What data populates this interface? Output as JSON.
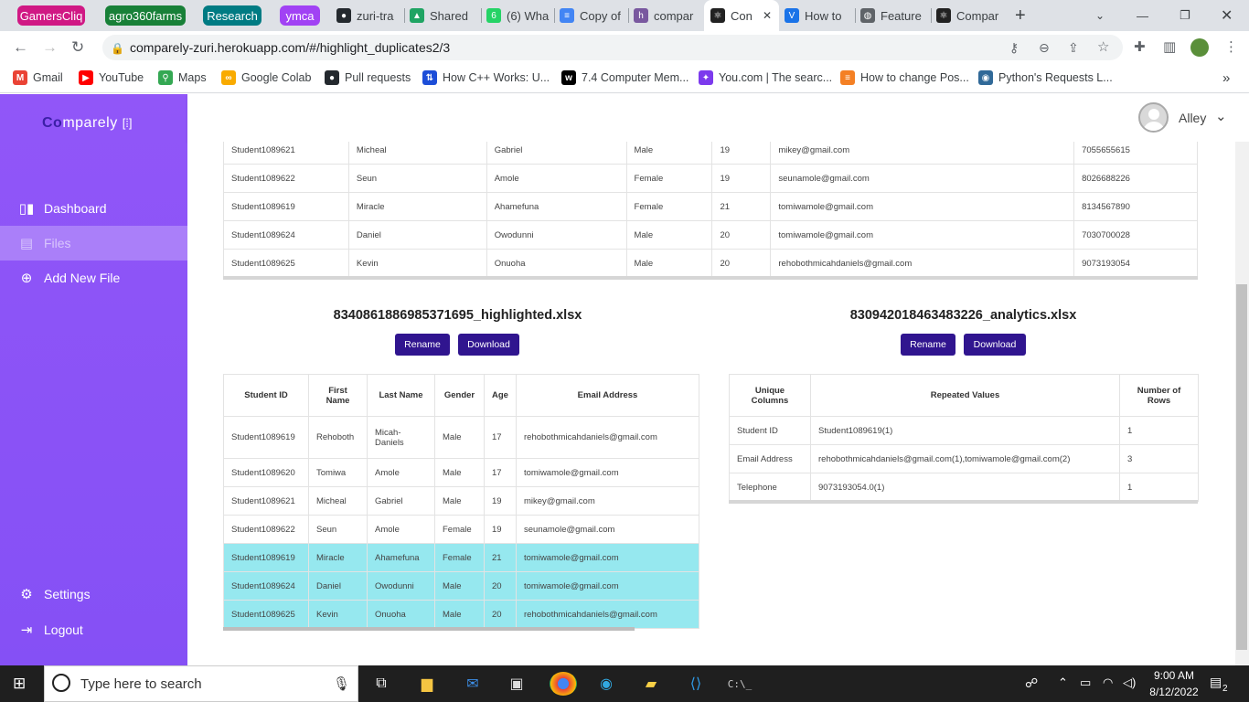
{
  "browser": {
    "tab_groups": [
      {
        "label": "GamersCliq",
        "color": "#d01884"
      },
      {
        "label": "agro360farms",
        "color": "#188038"
      },
      {
        "label": "Research",
        "color": "#007b83"
      },
      {
        "label": "ymca",
        "color": "#a142f4"
      }
    ],
    "tabs": [
      {
        "label": "zuri-tra",
        "icon": "github-icon"
      },
      {
        "label": "Shared",
        "icon": "drive-icon"
      },
      {
        "label": "(6) Wha",
        "icon": "whatsapp-icon"
      },
      {
        "label": "Copy of",
        "icon": "docs-icon"
      },
      {
        "label": "compar",
        "icon": "heroku-icon"
      },
      {
        "label": "Con",
        "icon": "react-icon",
        "active": true
      },
      {
        "label": "How to",
        "icon": "vercel-icon"
      },
      {
        "label": "Feature",
        "icon": "globe-icon"
      },
      {
        "label": "Compar",
        "icon": "react-icon"
      }
    ],
    "new_tab": "+",
    "url": "comparely-zuri.herokuapp.com/#/highlight_duplicates2/3",
    "bookmarks": [
      {
        "label": "Gmail",
        "icon": "gmail-icon"
      },
      {
        "label": "YouTube",
        "icon": "youtube-icon"
      },
      {
        "label": "Maps",
        "icon": "maps-icon"
      },
      {
        "label": "Google Colab",
        "icon": "colab-icon"
      },
      {
        "label": "Pull requests",
        "icon": "github-icon"
      },
      {
        "label": "How C++ Works: U...",
        "icon": "bookmark-icon"
      },
      {
        "label": "7.4 Computer Mem...",
        "icon": "w-icon"
      },
      {
        "label": "You.com | The searc...",
        "icon": "you-icon"
      },
      {
        "label": "How to change Pos...",
        "icon": "stackoverflow-icon"
      },
      {
        "label": "Python's Requests L...",
        "icon": "python-icon"
      }
    ],
    "more_bookmarks": "»"
  },
  "sidebar": {
    "logo_bold": "Co",
    "logo_rest": "mparely",
    "items": [
      {
        "label": "Dashboard",
        "icon": "chart-icon"
      },
      {
        "label": "Files",
        "icon": "file-icon",
        "active": true
      },
      {
        "label": "Add New File",
        "icon": "plus-circle-icon"
      }
    ],
    "bottom": [
      {
        "label": "Settings",
        "icon": "gear-icon"
      },
      {
        "label": "Logout",
        "icon": "logout-icon"
      }
    ]
  },
  "header": {
    "username": "Alley"
  },
  "top_table": {
    "rows": [
      [
        "Student1089621",
        "Micheal",
        "Gabriel",
        "Male",
        "19",
        "mikey@gmail.com",
        "7055655615"
      ],
      [
        "Student1089622",
        "Seun",
        "Amole",
        "Female",
        "19",
        "seunamole@gmail.com",
        "8026688226"
      ],
      [
        "Student1089619",
        "Miracle",
        "Ahamefuna",
        "Female",
        "21",
        "tomiwamole@gmail.com",
        "8134567890"
      ],
      [
        "Student1089624",
        "Daniel",
        "Owodunni",
        "Male",
        "20",
        "tomiwamole@gmail.com",
        "7030700028"
      ],
      [
        "Student1089625",
        "Kevin",
        "Onuoha",
        "Male",
        "20",
        "rehobothmicahdaniels@gmail.com",
        "9073193054"
      ]
    ]
  },
  "highlighted_file": {
    "name": "8340861886985371695_highlighted.xlsx",
    "rename_label": "Rename",
    "download_label": "Download",
    "columns": [
      "Student ID",
      "First Name",
      "Last Name",
      "Gender",
      "Age",
      "Email Address"
    ],
    "rows": [
      {
        "cells": [
          "Student1089619",
          "Rehoboth",
          "Micah-Daniels",
          "Male",
          "17",
          "rehobothmicahdaniels@gmail.com"
        ],
        "highlight": false
      },
      {
        "cells": [
          "Student1089620",
          "Tomiwa",
          "Amole",
          "Male",
          "17",
          "tomiwamole@gmail.com"
        ],
        "highlight": false
      },
      {
        "cells": [
          "Student1089621",
          "Micheal",
          "Gabriel",
          "Male",
          "19",
          "mikey@gmail.com"
        ],
        "highlight": false
      },
      {
        "cells": [
          "Student1089622",
          "Seun",
          "Amole",
          "Female",
          "19",
          "seunamole@gmail.com"
        ],
        "highlight": false
      },
      {
        "cells": [
          "Student1089619",
          "Miracle",
          "Ahamefuna",
          "Female",
          "21",
          "tomiwamole@gmail.com"
        ],
        "highlight": true
      },
      {
        "cells": [
          "Student1089624",
          "Daniel",
          "Owodunni",
          "Male",
          "20",
          "tomiwamole@gmail.com"
        ],
        "highlight": true
      },
      {
        "cells": [
          "Student1089625",
          "Kevin",
          "Onuoha",
          "Male",
          "20",
          "rehobothmicahdaniels@gmail.com"
        ],
        "highlight": true
      }
    ],
    "highlight_color": "#96e8ef"
  },
  "analytics_file": {
    "name": "830942018463483226_analytics.xlsx",
    "rename_label": "Rename",
    "download_label": "Download",
    "columns": [
      "Unique Columns",
      "Repeated Values",
      "Number of Rows"
    ],
    "rows": [
      [
        "Student ID",
        "Student1089619(1)",
        "1"
      ],
      [
        "Email Address",
        "rehobothmicahdaniels@gmail.com(1),tomiwamole@gmail.com(2)",
        "3"
      ],
      [
        "Telephone",
        "9073193054.0(1)",
        "1"
      ]
    ]
  },
  "taskbar": {
    "search_placeholder": "Type here to search",
    "time": "9:00 AM",
    "date": "8/12/2022",
    "notifications": "2"
  },
  "colors": {
    "sidebar": "#8a55f6",
    "button": "#30158f",
    "highlight": "#96e8ef"
  }
}
